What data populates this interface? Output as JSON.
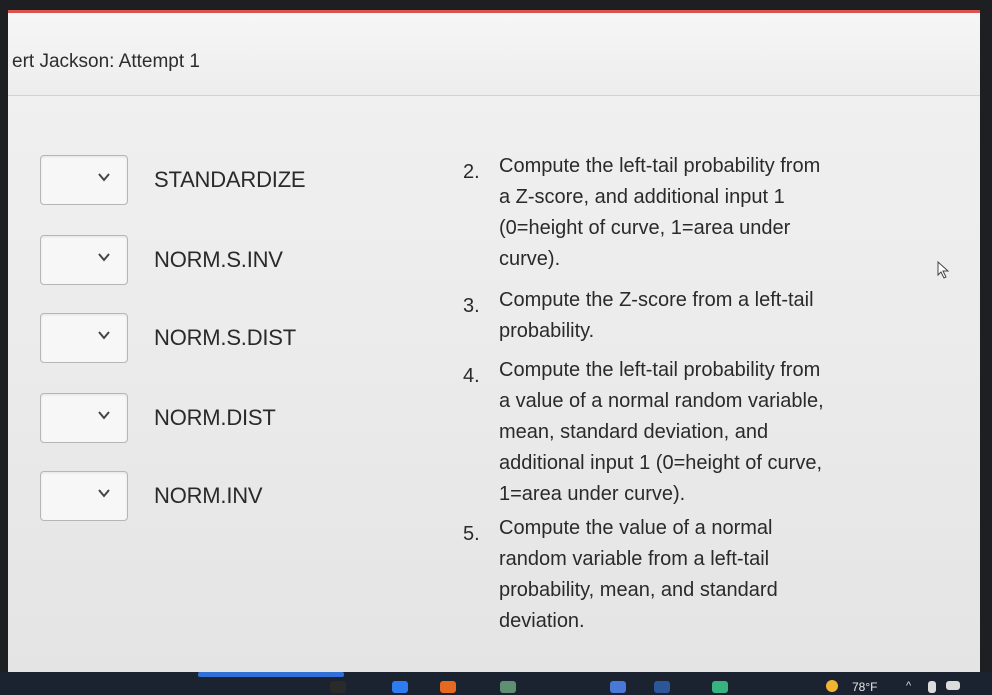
{
  "header": {
    "title": "ert Jackson: Attempt 1"
  },
  "matching": {
    "terms": [
      {
        "label": "STANDARDIZE"
      },
      {
        "label": "NORM.S.INV"
      },
      {
        "label": "NORM.S.DIST"
      },
      {
        "label": "NORM.DIST"
      },
      {
        "label": "NORM.INV"
      }
    ],
    "select_icon": "chevron-down-icon",
    "definitions": [
      {
        "num": "2.",
        "text": "Compute the left-tail probability from a Z-score, and additional input 1 (0=height of curve, 1=area under curve)."
      },
      {
        "num": "3.",
        "text": "Compute the Z-score from a left-tail probability."
      },
      {
        "num": "4.",
        "text": "Compute the left-tail probability from a value of a normal random variable, mean, standard deviation, and additional input 1 (0=height of curve, 1=area under curve)."
      },
      {
        "num": "5.",
        "text": "Compute the value of a normal random variable from a left-tail probability, mean, and standard deviation."
      }
    ]
  },
  "taskbar": {
    "weather": "78°F",
    "tray_chevron": "^"
  },
  "colors": {
    "accent_border": "#d9534f",
    "taskbar_bg": "#1b2330",
    "task_highlight": "#2f6fd6"
  }
}
